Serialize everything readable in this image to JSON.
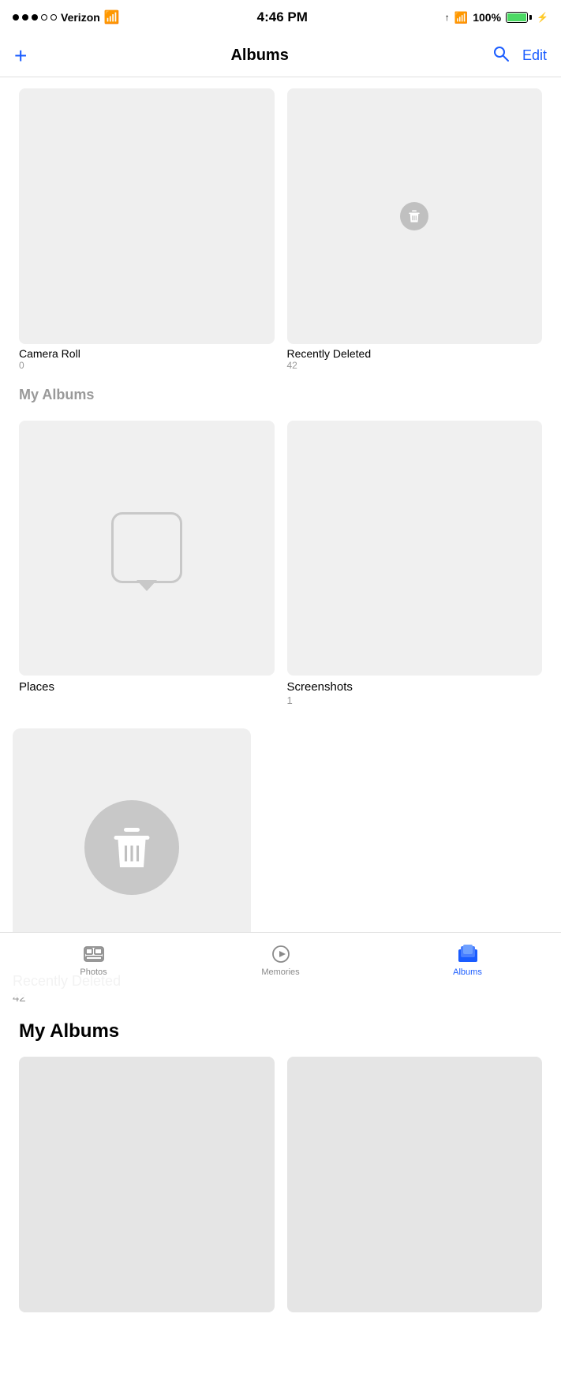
{
  "statusBar": {
    "carrier": "Verizon",
    "time": "4:46 PM",
    "battery": "100%",
    "signal_dots": [
      true,
      true,
      true,
      false,
      false
    ]
  },
  "navBar": {
    "title": "Albums",
    "addLabel": "+",
    "editLabel": "Edit"
  },
  "topAlbums": [
    {
      "name": "Camera Roll",
      "count": "0"
    },
    {
      "name": "Recently Deleted",
      "count": "42"
    }
  ],
  "myAlbumsHeader": "My Albums",
  "featuredAlbums": [
    {
      "name": "Places",
      "count": ""
    },
    {
      "name": "Screenshots",
      "count": "1"
    }
  ],
  "largeAlbum": {
    "name": "Recently Deleted",
    "count": "42"
  },
  "myAlbums": [
    {
      "name": "",
      "count": ""
    },
    {
      "name": "",
      "count": ""
    }
  ],
  "tabBar": {
    "tabs": [
      {
        "label": "Photos",
        "active": false
      },
      {
        "label": "Memories",
        "active": false
      },
      {
        "label": "Albums",
        "active": true
      }
    ]
  }
}
